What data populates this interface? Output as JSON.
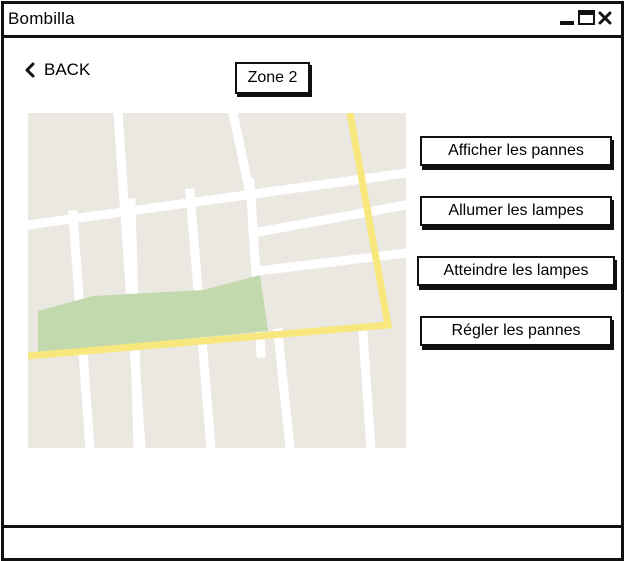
{
  "window": {
    "title": "Bombilla"
  },
  "nav": {
    "back_label": "BACK"
  },
  "page": {
    "title": "Zone 2"
  },
  "actions": [
    {
      "label": "Afficher les pannes"
    },
    {
      "label": "Allumer les lampes"
    },
    {
      "label": "Atteindre les lampes"
    },
    {
      "label": "Régler les pannes"
    }
  ],
  "map": {
    "colors": {
      "land": "#ebe8e2",
      "road": "#ffffff",
      "park": "#c2d9ae",
      "highlight": "#f7e77c"
    }
  }
}
